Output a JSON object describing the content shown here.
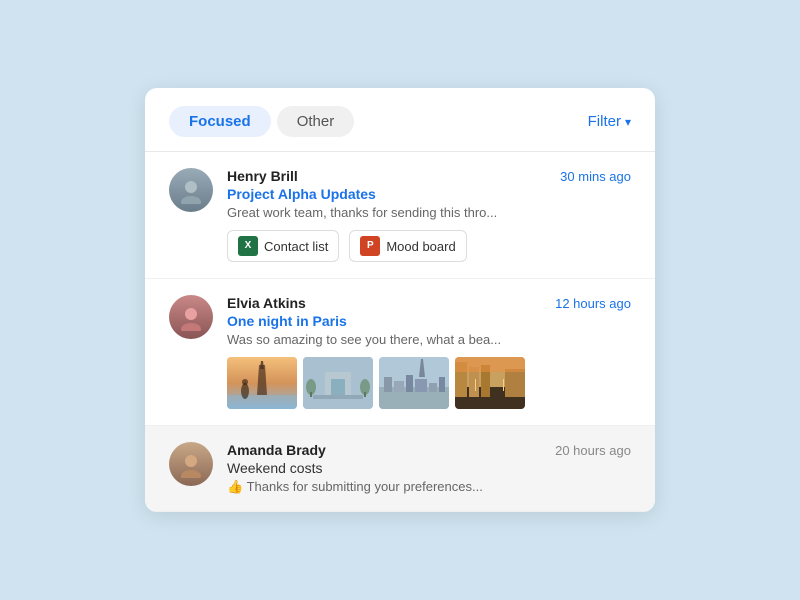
{
  "tabs": {
    "focused": {
      "label": "Focused",
      "active": true
    },
    "other": {
      "label": "Other",
      "active": false
    }
  },
  "filter": {
    "label": "Filter",
    "icon": "chevron-down"
  },
  "emails": [
    {
      "id": "henry",
      "sender": "Henry Brill",
      "subject": "Project Alpha Updates",
      "time": "30 mins ago",
      "preview": "Great work team, thanks for sending this thro...",
      "read": false,
      "attachments": [
        {
          "type": "excel",
          "name": "Contact list"
        },
        {
          "type": "ppt",
          "name": "Mood board"
        }
      ],
      "photos": []
    },
    {
      "id": "elvia",
      "sender": "Elvia Atkins",
      "subject": "One night in Paris",
      "time": "12 hours ago",
      "preview": "Was so amazing to see you there, what a bea...",
      "read": false,
      "attachments": [],
      "photos": [
        "paris-1",
        "paris-2",
        "paris-3",
        "paris-4"
      ]
    },
    {
      "id": "amanda",
      "sender": "Amanda Brady",
      "subject": "Weekend costs",
      "time": "20 hours ago",
      "preview": "👍 Thanks for submitting your preferences...",
      "read": true,
      "attachments": [],
      "photos": []
    }
  ]
}
